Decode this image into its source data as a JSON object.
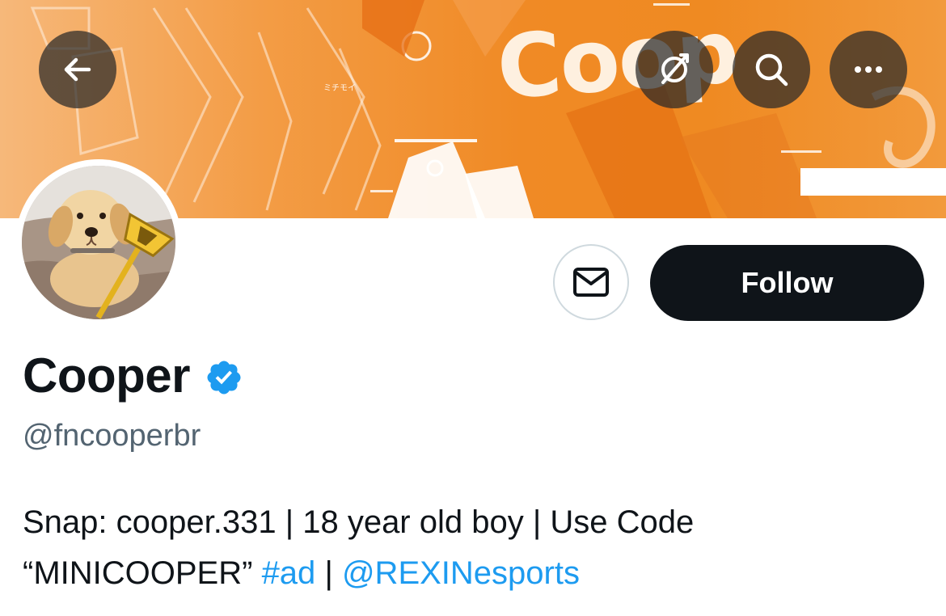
{
  "colors": {
    "banner_orange": "#f08a25",
    "follow_bg": "#0f1419",
    "follow_text": "#ffffff",
    "verified_blue": "#1d9bf0",
    "link_blue": "#1d9bf0",
    "handle_gray": "#536471"
  },
  "header_icons": {
    "back": "back-arrow-icon",
    "unfollow_notify": "slashed-circle-icon",
    "search": "search-icon",
    "more": "more-dots-icon"
  },
  "banner": {
    "text": "Coop"
  },
  "profile": {
    "avatar_icon": "avatar-golden-retriever-puppy",
    "message_icon": "envelope-icon",
    "follow_label": "Follow",
    "display_name": "Cooper",
    "verified_icon": "verified-badge-icon",
    "handle": "@fncooperbr",
    "bio": {
      "line1": "Snap: cooper.331 | 18 year old boy | Use Code",
      "line2_text": "“MINICOOPER”",
      "hashtag": "#ad",
      "separator": "|",
      "mention": "@REXINesports"
    }
  }
}
